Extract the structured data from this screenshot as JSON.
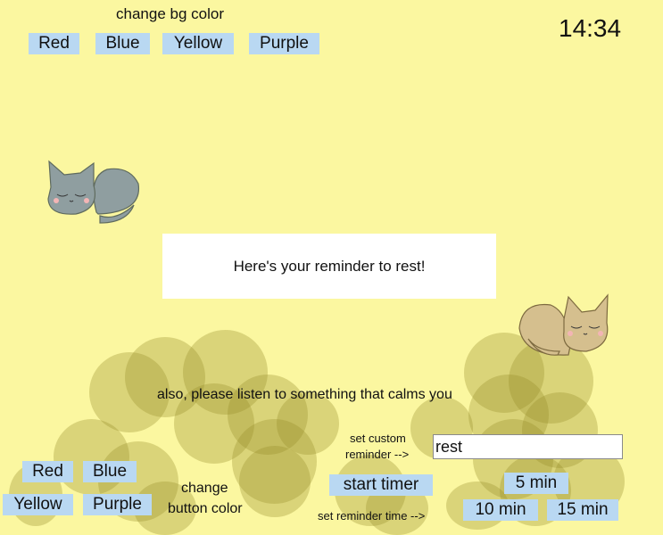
{
  "clock": "14:34",
  "bg_controls": {
    "label": "change bg color",
    "buttons": [
      "Red",
      "Blue",
      "Yellow",
      "Purple"
    ]
  },
  "reminder": {
    "message": "Here's your reminder to rest!",
    "calm_note": "also, please listen to something that calms you"
  },
  "button_controls": {
    "label_line1": "change",
    "label_line2": "button color",
    "buttons": [
      "Red",
      "Blue",
      "Yellow",
      "Purple"
    ]
  },
  "custom_reminder": {
    "label_line1": "set custom",
    "label_line2": "reminder -->",
    "value": "rest"
  },
  "timer": {
    "start_label": "start timer",
    "set_time_label": "set reminder time -->",
    "options": [
      "5 min",
      "10 min",
      "15 min"
    ]
  },
  "colors": {
    "background": "#fbf7a0",
    "button": "#b9d8f2",
    "bubble": "#968c28"
  },
  "icons": [
    "sleeping-gray-cat-icon",
    "sleeping-tan-cat-icon"
  ]
}
